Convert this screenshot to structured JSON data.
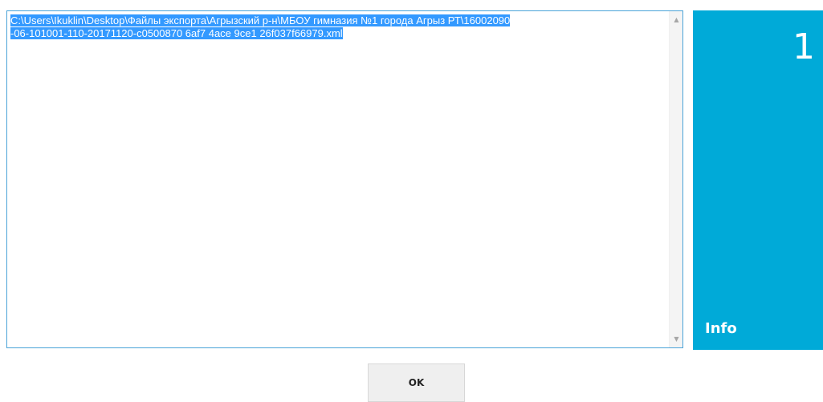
{
  "textarea": {
    "lines": [
      "C:\\Users\\Ikuklin\\Desktop\\Файлы экспорта\\Агрызский р-н\\МБОУ гимназия №1 города Агрыз РТ\\16002090",
      "-06-101001-110-20171120-c0500870 6af7 4ace 9ce1 26f037f66979.xml"
    ],
    "selected": true
  },
  "scrollbar": {
    "up_icon": "▲",
    "down_icon": "▼"
  },
  "tile": {
    "count": "1",
    "label": "Info",
    "color": "#00aad8"
  },
  "buttons": {
    "ok_label": "OK"
  }
}
